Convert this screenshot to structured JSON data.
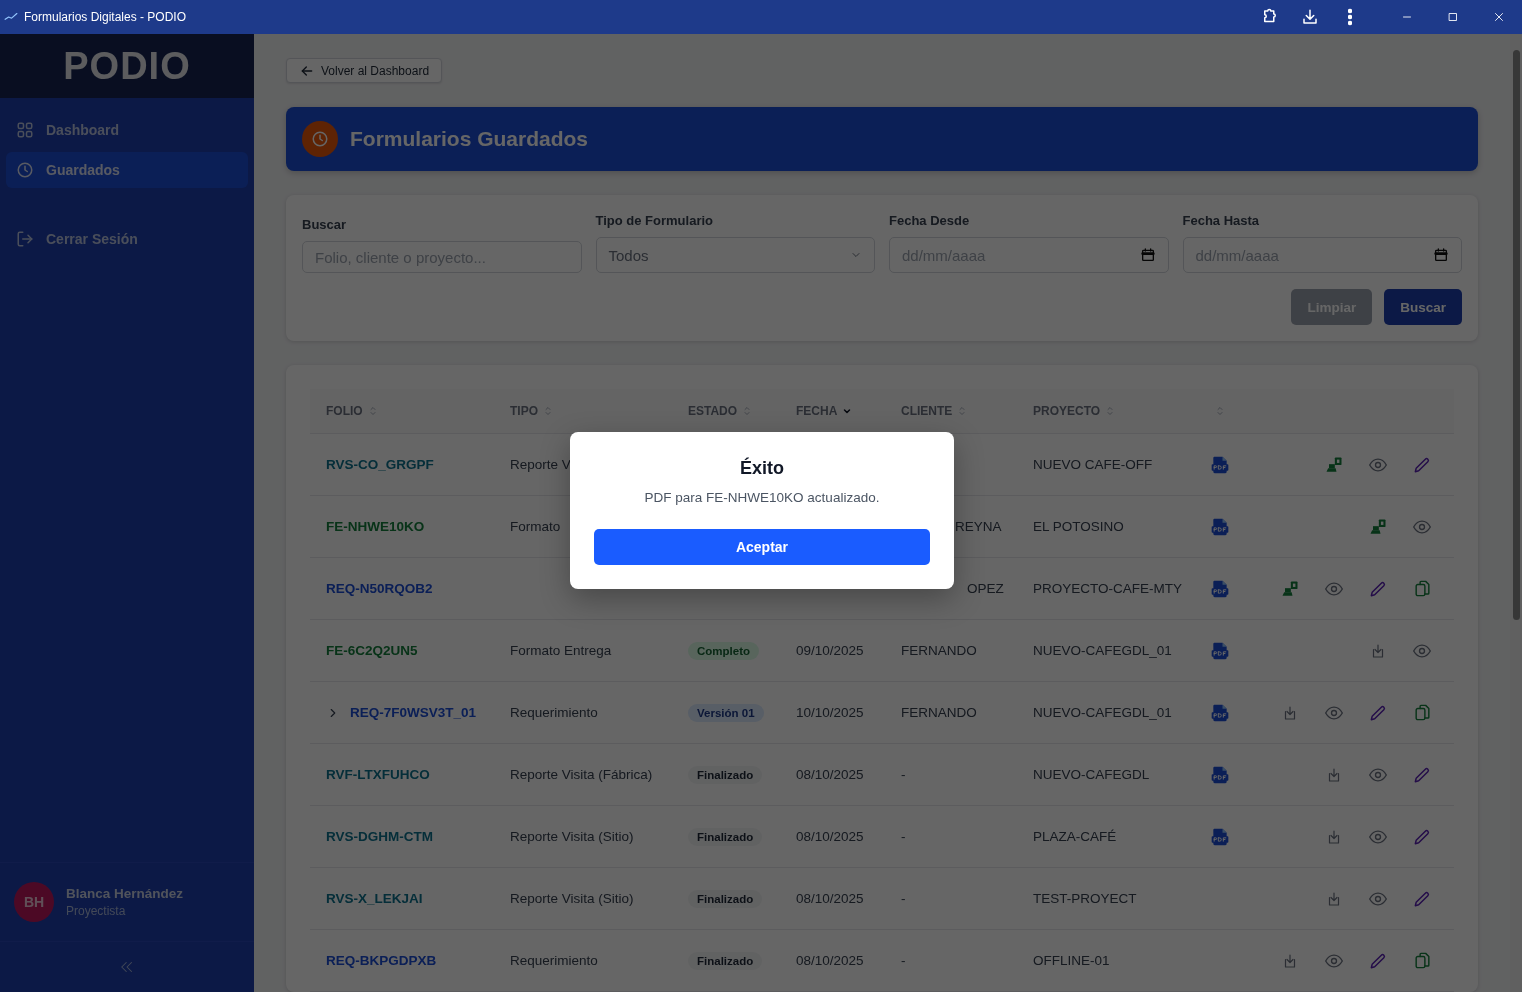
{
  "window": {
    "title": "Formularios Digitales - PODIO"
  },
  "sidebar": {
    "logo": "PODIO",
    "items": [
      {
        "label": "Dashboard",
        "selected": false
      },
      {
        "label": "Guardados",
        "selected": true
      }
    ],
    "logout": "Cerrar Sesión",
    "user": {
      "initials": "BH",
      "name": "Blanca Hernández",
      "role": "Proyectista"
    }
  },
  "back_button": "Volver al Dashboard",
  "page_title": "Formularios Guardados",
  "filters": {
    "search": {
      "label": "Buscar",
      "placeholder": "Folio, cliente o proyecto..."
    },
    "type": {
      "label": "Tipo de Formulario",
      "value": "Todos"
    },
    "date_from": {
      "label": "Fecha Desde",
      "placeholder": "dd/mm/aaaa"
    },
    "date_to": {
      "label": "Fecha Hasta",
      "placeholder": "dd/mm/aaaa"
    },
    "buttons": [
      {
        "label": "Limpiar",
        "kind": "secondary"
      },
      {
        "label": "Buscar",
        "kind": "primary"
      }
    ]
  },
  "table": {
    "columns": [
      {
        "label": "FOLIO",
        "sorted": false
      },
      {
        "label": "TIPO",
        "sorted": false
      },
      {
        "label": "ESTADO",
        "sorted": false
      },
      {
        "label": "FECHA",
        "sorted": true
      },
      {
        "label": "CLIENTE",
        "sorted": false
      },
      {
        "label": "PROYECTO",
        "sorted": false
      },
      {
        "sorted": false
      }
    ],
    "rows": [
      {
        "folio": "RVS-CO_GRGPF",
        "kind": "reporte",
        "tipo": "Reporte V",
        "proyecto": "NUEVO CAFE-OFF",
        "pdf": true,
        "actions": [
          {
            "kind": "send"
          },
          {
            "kind": "view"
          },
          {
            "kind": "edit"
          }
        ]
      },
      {
        "folio": "FE-NHWE10KO",
        "kind": "formato",
        "tipo": "Formato",
        "cliente": "REYNA",
        "proyecto": "EL POTOSINO",
        "pdf": true,
        "actions": [
          {
            "kind": "send"
          },
          {
            "kind": "view"
          }
        ]
      },
      {
        "folio": "REQ-N50RQOB2",
        "kind": "requerimiento",
        "cliente": "OPEZ",
        "proyecto": "PROYECTO-CAFE-MTY",
        "pdf": true,
        "actions": [
          {
            "kind": "send"
          },
          {
            "kind": "view"
          },
          {
            "kind": "edit"
          },
          {
            "kind": "copy"
          }
        ]
      },
      {
        "folio": "FE-6C2Q2UN5",
        "kind": "formato",
        "tipo": "Formato Entrega",
        "estado": {
          "label": "Completo",
          "kind": "completo"
        },
        "fecha": "09/10/2025",
        "cliente": "FERNANDO",
        "proyecto": "NUEVO-CAFEGDL_01",
        "pdf": true,
        "actions": [
          {
            "kind": "download"
          },
          {
            "kind": "view"
          }
        ]
      },
      {
        "folio": "REQ-7F0WSV3T_01",
        "kind": "requerimiento",
        "expanded": false,
        "tipo": "Requerimiento",
        "estado": {
          "label": "Versión 01",
          "kind": "version"
        },
        "fecha": "10/10/2025",
        "cliente": "FERNANDO",
        "proyecto": "NUEVO-CAFEGDL_01",
        "pdf": true,
        "actions": [
          {
            "kind": "download"
          },
          {
            "kind": "view"
          },
          {
            "kind": "edit"
          },
          {
            "kind": "copy"
          }
        ]
      },
      {
        "folio": "RVF-LTXFUHCO",
        "kind": "reporte",
        "tipo": "Reporte Visita (Fábrica)",
        "estado": {
          "label": "Finalizado",
          "kind": "finalizado"
        },
        "fecha": "08/10/2025",
        "cliente": "-",
        "proyecto": "NUEVO-CAFEGDL",
        "pdf": true,
        "actions": [
          {
            "kind": "download"
          },
          {
            "kind": "view"
          },
          {
            "kind": "edit"
          }
        ]
      },
      {
        "folio": "RVS-DGHM-CTM",
        "kind": "reporte",
        "tipo": "Reporte Visita (Sitio)",
        "estado": {
          "label": "Finalizado",
          "kind": "finalizado"
        },
        "fecha": "08/10/2025",
        "cliente": "-",
        "proyecto": "PLAZA-CAFÉ",
        "pdf": true,
        "actions": [
          {
            "kind": "download"
          },
          {
            "kind": "view"
          },
          {
            "kind": "edit"
          }
        ]
      },
      {
        "folio": "RVS-X_LEKJAI",
        "kind": "reporte",
        "tipo": "Reporte Visita (Sitio)",
        "estado": {
          "label": "Finalizado",
          "kind": "finalizado"
        },
        "fecha": "08/10/2025",
        "cliente": "-",
        "proyecto": "TEST-PROYECT",
        "pdf": false,
        "actions": [
          {
            "kind": "download"
          },
          {
            "kind": "view"
          },
          {
            "kind": "edit"
          }
        ]
      },
      {
        "folio": "REQ-BKPGDPXB",
        "kind": "requerimiento",
        "tipo": "Requerimiento",
        "estado": {
          "label": "Finalizado",
          "kind": "finalizado"
        },
        "fecha": "08/10/2025",
        "cliente": "-",
        "proyecto": "OFFLINE-01",
        "pdf": false,
        "actions": [
          {
            "kind": "download"
          },
          {
            "kind": "view"
          },
          {
            "kind": "edit"
          },
          {
            "kind": "copy"
          }
        ]
      }
    ]
  },
  "modal": {
    "title": "Éxito",
    "message": "PDF para FE-NHWE10KO actualizado.",
    "button": "Aceptar"
  }
}
